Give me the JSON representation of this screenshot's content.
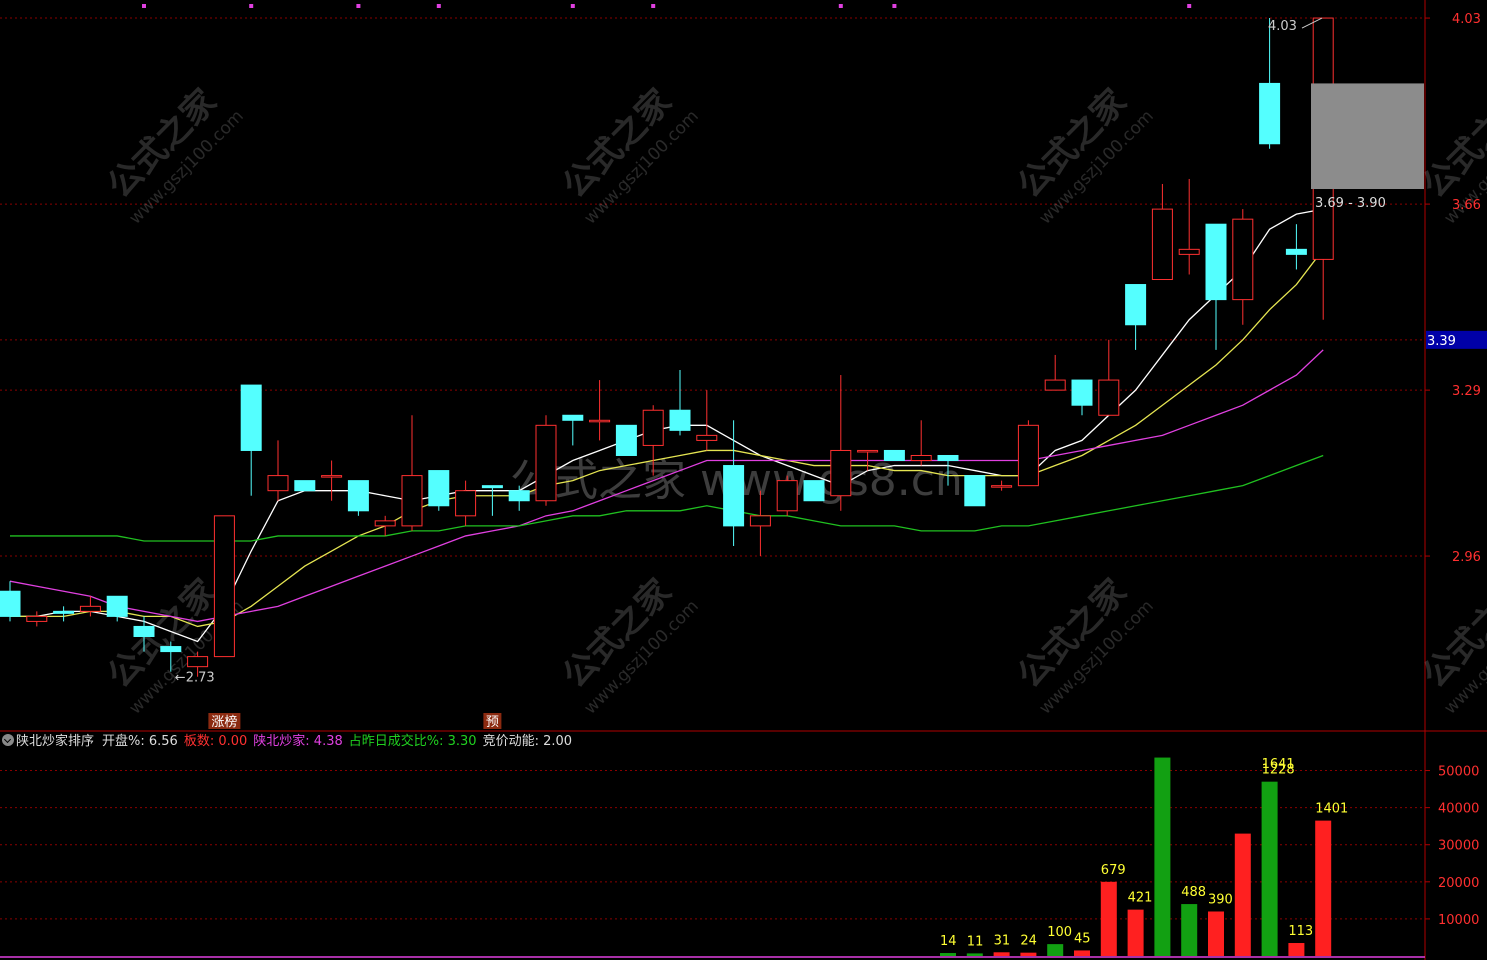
{
  "chart_data": [
    {
      "type": "candlestick",
      "ylim": [
        2.62,
        4.05
      ],
      "price_ticks": [
        "4.03",
        "3.66",
        "3.39",
        "3.29",
        "2.96"
      ],
      "current_price": "3.39",
      "labels": {
        "low": "2.73",
        "high": "4.03",
        "target": "3.69 - 3.90"
      },
      "markers": [
        {
          "index": 8,
          "text": "涨榜"
        },
        {
          "index": 18,
          "text": "预"
        }
      ],
      "candles": [
        {
          "o": 2.89,
          "h": 2.91,
          "l": 2.83,
          "c": 2.84,
          "up": false
        },
        {
          "o": 2.84,
          "h": 2.85,
          "l": 2.82,
          "c": 2.83,
          "up": true
        },
        {
          "o": 2.85,
          "h": 2.86,
          "l": 2.83,
          "c": 2.85,
          "up": false
        },
        {
          "o": 2.86,
          "h": 2.88,
          "l": 2.84,
          "c": 2.85,
          "up": true
        },
        {
          "o": 2.88,
          "h": 2.88,
          "l": 2.83,
          "c": 2.84,
          "up": false
        },
        {
          "o": 2.82,
          "h": 2.84,
          "l": 2.77,
          "c": 2.8,
          "up": false
        },
        {
          "o": 2.78,
          "h": 2.79,
          "l": 2.73,
          "c": 2.77,
          "up": false
        },
        {
          "o": 2.74,
          "h": 2.77,
          "l": 2.72,
          "c": 2.76,
          "up": true
        },
        {
          "o": 2.76,
          "h": 3.04,
          "l": 2.76,
          "c": 3.04,
          "up": true
        },
        {
          "o": 3.3,
          "h": 3.3,
          "l": 3.08,
          "c": 3.17,
          "up": false
        },
        {
          "o": 3.09,
          "h": 3.19,
          "l": 3.07,
          "c": 3.12,
          "up": true
        },
        {
          "o": 3.11,
          "h": 3.11,
          "l": 3.09,
          "c": 3.09,
          "up": false
        },
        {
          "o": 3.12,
          "h": 3.15,
          "l": 3.07,
          "c": 3.12,
          "up": true
        },
        {
          "o": 3.11,
          "h": 3.11,
          "l": 3.04,
          "c": 3.05,
          "up": false
        },
        {
          "o": 3.02,
          "h": 3.04,
          "l": 3.0,
          "c": 3.03,
          "up": true
        },
        {
          "o": 3.02,
          "h": 3.24,
          "l": 3.01,
          "c": 3.12,
          "up": true
        },
        {
          "o": 3.13,
          "h": 3.13,
          "l": 3.05,
          "c": 3.06,
          "up": false
        },
        {
          "o": 3.04,
          "h": 3.11,
          "l": 3.02,
          "c": 3.09,
          "up": true
        },
        {
          "o": 3.1,
          "h": 3.1,
          "l": 3.04,
          "c": 3.1,
          "up": false
        },
        {
          "o": 3.09,
          "h": 3.1,
          "l": 3.05,
          "c": 3.07,
          "up": false
        },
        {
          "o": 3.07,
          "h": 3.24,
          "l": 3.06,
          "c": 3.22,
          "up": true
        },
        {
          "o": 3.24,
          "h": 3.24,
          "l": 3.18,
          "c": 3.23,
          "up": false
        },
        {
          "o": 3.23,
          "h": 3.31,
          "l": 3.19,
          "c": 3.23,
          "up": true
        },
        {
          "o": 3.22,
          "h": 3.22,
          "l": 3.16,
          "c": 3.16,
          "up": false
        },
        {
          "o": 3.18,
          "h": 3.26,
          "l": 3.12,
          "c": 3.25,
          "up": true
        },
        {
          "o": 3.25,
          "h": 3.33,
          "l": 3.2,
          "c": 3.21,
          "up": false
        },
        {
          "o": 3.2,
          "h": 3.29,
          "l": 3.17,
          "c": 3.19,
          "up": true
        },
        {
          "o": 3.14,
          "h": 3.23,
          "l": 2.98,
          "c": 3.02,
          "up": false
        },
        {
          "o": 3.04,
          "h": 3.09,
          "l": 2.96,
          "c": 3.02,
          "up": true
        },
        {
          "o": 3.05,
          "h": 3.12,
          "l": 3.04,
          "c": 3.11,
          "up": true
        },
        {
          "o": 3.11,
          "h": 3.11,
          "l": 3.07,
          "c": 3.07,
          "up": false
        },
        {
          "o": 3.08,
          "h": 3.32,
          "l": 3.05,
          "c": 3.17,
          "up": true
        },
        {
          "o": 3.17,
          "h": 3.17,
          "l": 3.13,
          "c": 3.17,
          "up": true
        },
        {
          "o": 3.17,
          "h": 3.17,
          "l": 3.15,
          "c": 3.15,
          "up": false
        },
        {
          "o": 3.15,
          "h": 3.23,
          "l": 3.14,
          "c": 3.16,
          "up": true
        },
        {
          "o": 3.16,
          "h": 3.16,
          "l": 3.1,
          "c": 3.15,
          "up": false
        },
        {
          "o": 3.12,
          "h": 3.12,
          "l": 3.07,
          "c": 3.06,
          "up": false
        },
        {
          "o": 3.1,
          "h": 3.11,
          "l": 3.09,
          "c": 3.1,
          "up": true
        },
        {
          "o": 3.1,
          "h": 3.23,
          "l": 3.1,
          "c": 3.22,
          "up": true
        },
        {
          "o": 3.31,
          "h": 3.36,
          "l": 3.29,
          "c": 3.29,
          "up": true
        },
        {
          "o": 3.31,
          "h": 3.31,
          "l": 3.24,
          "c": 3.26,
          "up": false
        },
        {
          "o": 3.24,
          "h": 3.39,
          "l": 3.24,
          "c": 3.31,
          "up": true
        },
        {
          "o": 3.5,
          "h": 3.5,
          "l": 3.37,
          "c": 3.42,
          "up": false
        },
        {
          "o": 3.51,
          "h": 3.7,
          "l": 3.51,
          "c": 3.65,
          "up": true
        },
        {
          "o": 3.56,
          "h": 3.71,
          "l": 3.52,
          "c": 3.57,
          "up": true
        },
        {
          "o": 3.62,
          "h": 3.62,
          "l": 3.37,
          "c": 3.47,
          "up": false
        },
        {
          "o": 3.47,
          "h": 3.65,
          "l": 3.42,
          "c": 3.63,
          "up": true
        },
        {
          "o": 3.9,
          "h": 4.03,
          "l": 3.77,
          "c": 3.78,
          "up": false
        },
        {
          "o": 3.57,
          "h": 3.62,
          "l": 3.53,
          "c": 3.56,
          "up": false
        },
        {
          "o": 3.55,
          "h": 3.7,
          "l": 3.43,
          "c": 4.03,
          "up": true
        }
      ],
      "ma_series": [
        {
          "color": "#ffffff",
          "values": [
            2.84,
            2.84,
            2.85,
            2.85,
            2.84,
            2.83,
            2.81,
            2.79,
            2.86,
            2.97,
            3.07,
            3.09,
            3.09,
            3.09,
            3.08,
            3.07,
            3.08,
            3.09,
            3.09,
            3.09,
            3.12,
            3.15,
            3.17,
            3.19,
            3.21,
            3.22,
            3.22,
            3.19,
            3.16,
            3.14,
            3.12,
            3.1,
            3.13,
            3.14,
            3.14,
            3.14,
            3.13,
            3.12,
            3.12,
            3.17,
            3.19,
            3.24,
            3.29,
            3.36,
            3.43,
            3.48,
            3.53,
            3.61,
            3.64,
            3.65
          ]
        },
        {
          "color": "#e5e552",
          "values": [
            2.84,
            2.84,
            2.84,
            2.85,
            2.85,
            2.84,
            2.84,
            2.82,
            2.83,
            2.86,
            2.9,
            2.94,
            2.97,
            3.0,
            3.02,
            3.05,
            3.07,
            3.08,
            3.08,
            3.08,
            3.1,
            3.11,
            3.13,
            3.14,
            3.15,
            3.16,
            3.17,
            3.17,
            3.16,
            3.15,
            3.14,
            3.14,
            3.14,
            3.13,
            3.13,
            3.12,
            3.12,
            3.12,
            3.12,
            3.14,
            3.16,
            3.19,
            3.22,
            3.26,
            3.3,
            3.34,
            3.39,
            3.45,
            3.5,
            3.57
          ]
        },
        {
          "color": "#e040e0",
          "values": [
            2.91,
            2.9,
            2.89,
            2.88,
            2.86,
            2.85,
            2.84,
            2.83,
            2.84,
            2.85,
            2.86,
            2.88,
            2.9,
            2.92,
            2.94,
            2.96,
            2.98,
            3.0,
            3.01,
            3.02,
            3.04,
            3.05,
            3.07,
            3.09,
            3.11,
            3.13,
            3.15,
            3.15,
            3.15,
            3.15,
            3.15,
            3.15,
            3.15,
            3.15,
            3.15,
            3.15,
            3.15,
            3.15,
            3.15,
            3.16,
            3.17,
            3.18,
            3.19,
            3.2,
            3.22,
            3.24,
            3.26,
            3.29,
            3.32,
            3.37
          ]
        },
        {
          "color": "#20c020",
          "values": [
            3.0,
            3.0,
            3.0,
            3.0,
            3.0,
            2.99,
            2.99,
            2.99,
            2.99,
            2.99,
            3.0,
            3.0,
            3.0,
            3.0,
            3.0,
            3.01,
            3.01,
            3.02,
            3.02,
            3.02,
            3.03,
            3.04,
            3.04,
            3.05,
            3.05,
            3.05,
            3.06,
            3.05,
            3.04,
            3.04,
            3.03,
            3.02,
            3.02,
            3.02,
            3.01,
            3.01,
            3.01,
            3.02,
            3.02,
            3.03,
            3.04,
            3.05,
            3.06,
            3.07,
            3.08,
            3.09,
            3.1,
            3.12,
            3.14,
            3.16
          ]
        }
      ]
    },
    {
      "type": "bar",
      "y_ticks": [
        "50000",
        "40000",
        "30000",
        "20000",
        "10000"
      ],
      "ylim": [
        0,
        55000
      ],
      "bars": [
        {
          "index": 35,
          "value": 800,
          "label": "14",
          "color": "#12a012"
        },
        {
          "index": 36,
          "value": 700,
          "label": "11",
          "color": "#12a012"
        },
        {
          "index": 37,
          "value": 1000,
          "label": "31",
          "color": "#ff2020"
        },
        {
          "index": 38,
          "value": 900,
          "label": "24",
          "color": "#ff2020"
        },
        {
          "index": 39,
          "value": 3200,
          "label": "100",
          "color": "#12a012"
        },
        {
          "index": 40,
          "value": 1500,
          "label": "45",
          "color": "#ff2020"
        },
        {
          "index": 41,
          "value": 20000,
          "label": "679",
          "color": "#ff2020"
        },
        {
          "index": 42,
          "value": 12500,
          "label": "421",
          "color": "#ff2020"
        },
        {
          "index": 43,
          "value": 53500,
          "label": "",
          "color": "#12a012"
        },
        {
          "index": 44,
          "value": 14000,
          "label": "488",
          "color": "#12a012"
        },
        {
          "index": 45,
          "value": 12000,
          "label": "390",
          "color": "#ff2020"
        },
        {
          "index": 46,
          "value": 33000,
          "label": "",
          "color": "#ff2020"
        },
        {
          "index": 47,
          "value": 47000,
          "label": "1228",
          "color": "#12a012"
        },
        {
          "index": 48,
          "value": 3500,
          "label": "113",
          "color": "#ff2020"
        },
        {
          "index": 49,
          "value": 36500,
          "label": "1401",
          "color": "#ff2020"
        }
      ],
      "extra_labels": [
        {
          "index": 47,
          "text": "1641"
        }
      ]
    }
  ],
  "infobar": {
    "title": "陕北炒家排序",
    "items": [
      {
        "text": "开盘%: 6.56",
        "color": "#dddddd"
      },
      {
        "text": "板数: 0.00",
        "color": "#ff3030"
      },
      {
        "text": "陕北炒家: 4.38",
        "color": "#e040e0"
      },
      {
        "text": "占昨日成交比%: 3.30",
        "color": "#20d020"
      },
      {
        "text": "竞价动能: 2.00",
        "color": "#dddddd"
      }
    ]
  },
  "watermarks": {
    "cn": "公式之家",
    "url": "www.gszj100.com",
    "center": "公式之家 www.gs8.cn"
  },
  "colors": {
    "up": "#ff3030",
    "down": "#54ffff",
    "grid": "#8a0000",
    "axis": "#b00000"
  }
}
